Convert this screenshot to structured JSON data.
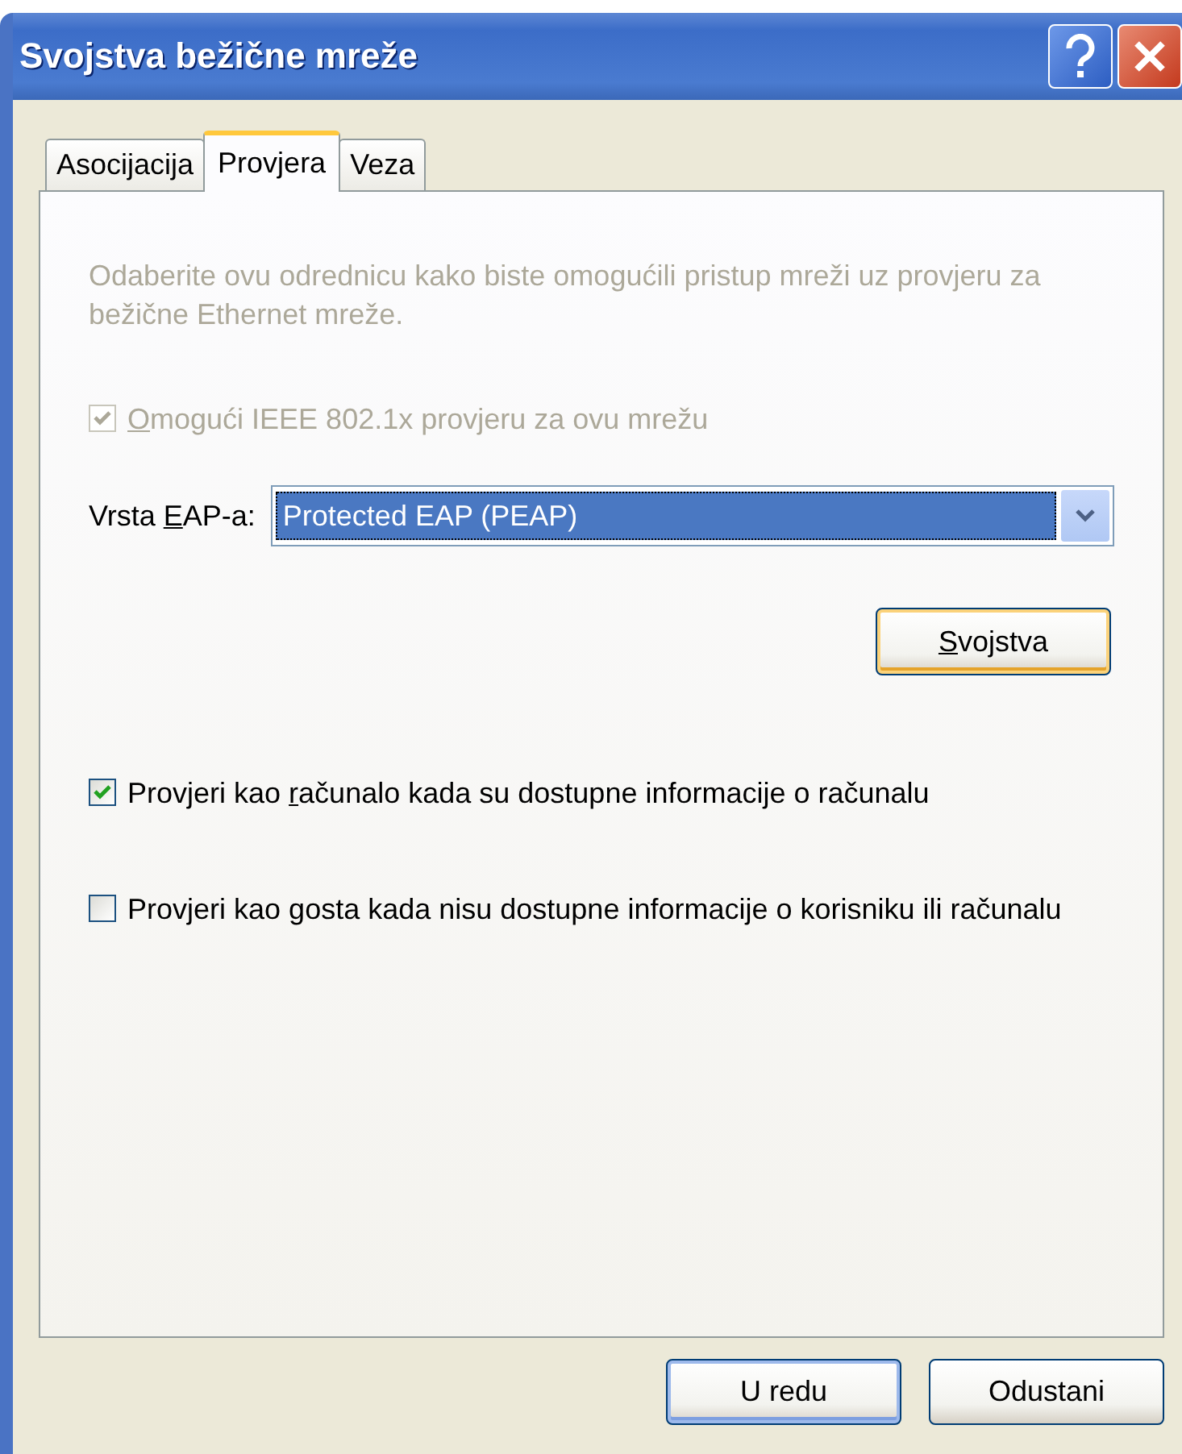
{
  "window": {
    "title": "Svojstva bežične mreže"
  },
  "tabs": [
    {
      "label": "Asocijacija",
      "selected": false
    },
    {
      "label": "Provjera",
      "selected": true
    },
    {
      "label": "Veza",
      "selected": false
    }
  ],
  "description": "Odaberite ovu odrednicu kako biste omogućili pristup mreži uz provjeru za bežične Ethernet mreže.",
  "ieee_checkbox": {
    "access_key": "O",
    "label_after": "mogući IEEE 802.1x provjeru za ovu mrežu",
    "checked": true,
    "disabled": true
  },
  "eap_type": {
    "label_before": "Vrsta ",
    "access_key": "E",
    "label_after": "AP-a:",
    "value": "Protected EAP (PEAP)"
  },
  "properties_button": {
    "access_key": "S",
    "label_after": "vojstva",
    "highlighted": true
  },
  "checkboxes": [
    {
      "label_before": "Provjeri kao ",
      "access_key": "r",
      "label_after": "ačunalo kada su dostupne informacije o računalu",
      "checked": true,
      "disabled": false
    },
    {
      "label_before": "Provjeri kao ",
      "access_key": "g",
      "label_after": "osta kada nisu dostupne informacije o korisniku ili računalu",
      "checked": false,
      "disabled": false
    }
  ],
  "buttons": [
    {
      "label": "U redu",
      "default": true
    },
    {
      "label": "Odustani",
      "default": false
    }
  ]
}
